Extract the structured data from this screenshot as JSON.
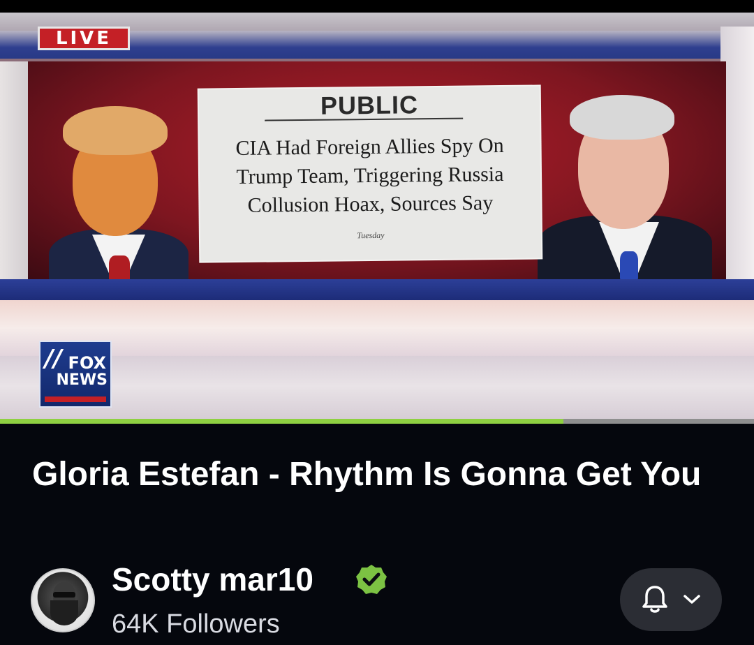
{
  "video": {
    "live_label": "LIVE",
    "card": {
      "publication": "PUBLIC",
      "headline": "CIA Had Foreign Allies Spy On Trump Team, Triggering Russia Collusion Hoax, Sources Say",
      "date": "Tuesday"
    },
    "network_logo": {
      "line1": "FOX",
      "line2": "NEWS",
      "sub": "channel"
    },
    "progress_fraction": 0.747
  },
  "title": "Gloria Estefan - Rhythm Is Gonna Get You",
  "channel": {
    "name": "Scotty mar10",
    "verified_icon": "verified-check-icon",
    "followers": "64K Followers"
  },
  "follow_button": {
    "icons": [
      "bell-icon",
      "chevron-down-icon"
    ]
  },
  "colors": {
    "background": "#05070d",
    "progress": "#8fd042",
    "verified": "#7cc243",
    "button_bg": "#2b2d34"
  }
}
